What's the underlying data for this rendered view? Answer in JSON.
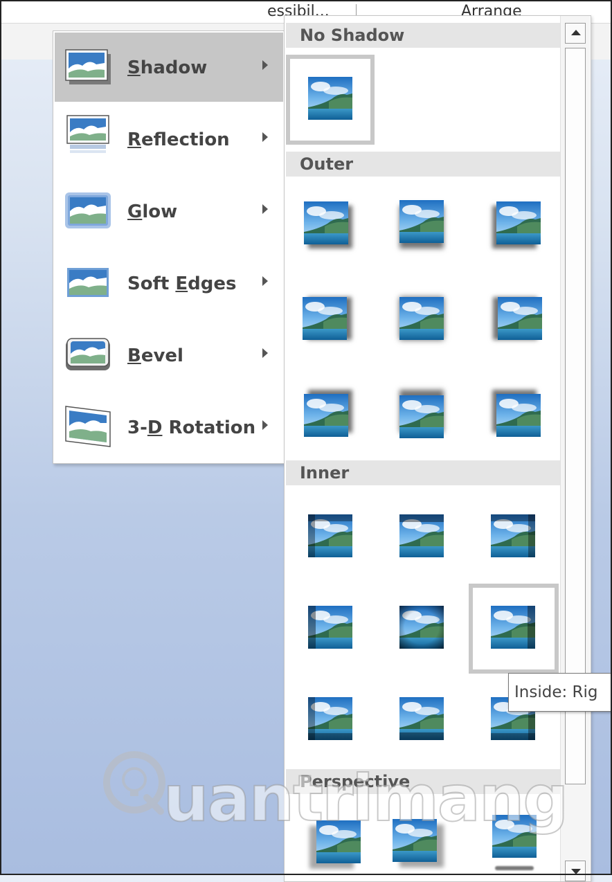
{
  "ribbon": {
    "left_label": "essibil...",
    "right_label": "Arrange"
  },
  "menu": {
    "items": [
      {
        "label": "Shadow",
        "accel": "S",
        "before": "",
        "after": "hadow",
        "icon": "shadow-effect-icon",
        "active": true
      },
      {
        "label": "Reflection",
        "accel": "R",
        "before": "",
        "after": "eflection",
        "icon": "reflection-effect-icon",
        "active": false
      },
      {
        "label": "Glow",
        "accel": "G",
        "before": "",
        "after": "low",
        "icon": "glow-effect-icon",
        "active": false
      },
      {
        "label": "Soft Edges",
        "accel": "E",
        "before": "Soft ",
        "after": "dges",
        "icon": "soft-edges-effect-icon",
        "active": false
      },
      {
        "label": "Bevel",
        "accel": "B",
        "before": "",
        "after": "evel",
        "icon": "bevel-effect-icon",
        "active": false
      },
      {
        "label": "3-D Rotation",
        "accel": "D",
        "before": "3-",
        "after": " Rotation",
        "icon": "3d-rotation-effect-icon",
        "active": false
      }
    ]
  },
  "gallery": {
    "sections": [
      "No Shadow",
      "Outer",
      "Inner",
      "Perspective"
    ]
  },
  "tooltip": {
    "text": "Inside: Rig"
  },
  "watermark": {
    "text": "uantrimang"
  },
  "colors": {
    "accent_blue": "#3a7cc4",
    "hover_gray": "#c6c6c6",
    "header_gray": "#e5e5e5"
  }
}
